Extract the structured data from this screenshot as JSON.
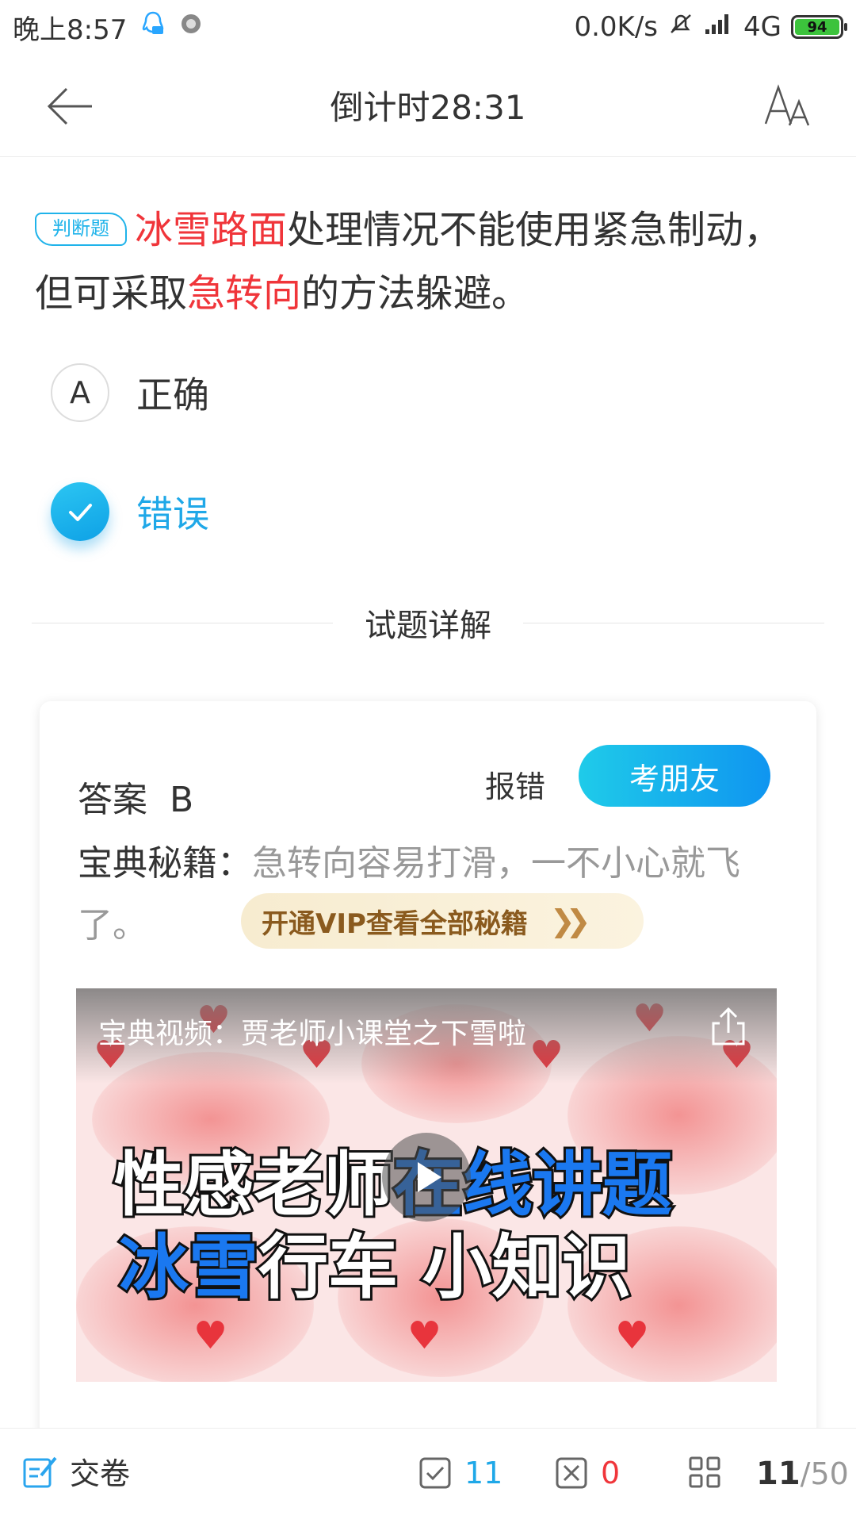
{
  "status_bar": {
    "time": "晚上8:57",
    "network_speed": "0.0K/s",
    "network_type": "4G",
    "battery": "94"
  },
  "header": {
    "title": "倒计时28:31"
  },
  "question": {
    "tag": "判断题",
    "text_parts": [
      "冰雪路面",
      "处理情况不能使用紧急制动，但可采取",
      "急转向",
      "的方法躲避。"
    ]
  },
  "options": [
    {
      "letter": "A",
      "label": "正确",
      "selected": false
    },
    {
      "letter": "",
      "label": "错误",
      "selected": true
    }
  ],
  "explanation": {
    "divider_title": "试题详解",
    "answer_label": "答案",
    "answer_value": "B",
    "report_label": "报错",
    "friend_button": "考朋友",
    "secret_label": "宝典秘籍：",
    "secret_text": "急转向容易打滑，一不小心就飞了。",
    "vip_button": "开通VIP查看全部秘籍",
    "video": {
      "title": "宝典视频：贾老师小课堂之下雪啦",
      "banner_line1_white": "性感老师",
      "banner_line1_blue": "在线讲题",
      "banner_line2_blue": "冰雪",
      "banner_line2_white": "行车 小知识"
    }
  },
  "bottom_bar": {
    "submit_label": "交卷",
    "correct_count": "11",
    "wrong_count": "0",
    "current": "11",
    "total": "/50"
  },
  "colors": {
    "accent": "#1fa8e8",
    "highlight_red": "#f0353a",
    "correct_green": "#1fa8e8",
    "wrong_red": "#f0353a"
  }
}
